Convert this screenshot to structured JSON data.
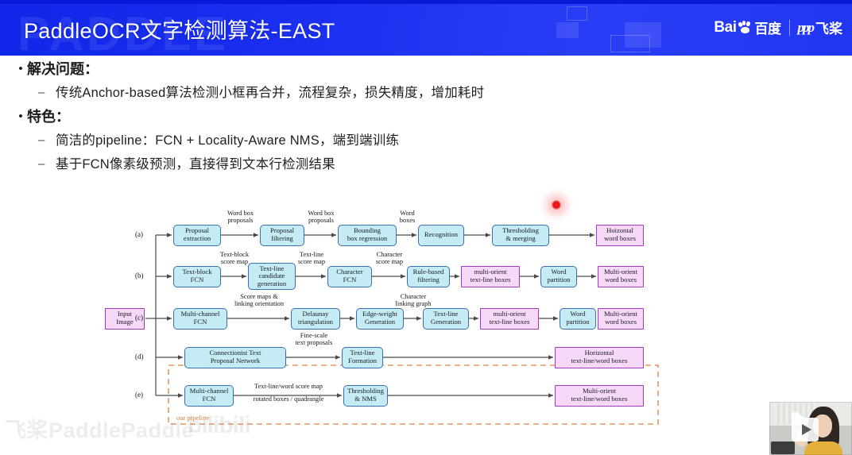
{
  "header": {
    "title": "PaddleOCR文字检测算法-EAST",
    "watermark_text": "PADDLE",
    "logo_baidu_latin": "Bai",
    "logo_baidu_cn": "百度",
    "logo_paddle_mark": "ppp",
    "logo_paddle_cn": "飞桨"
  },
  "content": {
    "bullets": [
      {
        "level": 1,
        "marker": "•",
        "text": "解决问题："
      },
      {
        "level": 2,
        "marker": "–",
        "text": "传统Anchor-based算法检测小框再合并，流程复杂，损失精度，增加耗时"
      },
      {
        "level": 1,
        "marker": "•",
        "text": "特色："
      },
      {
        "level": 2,
        "marker": "–",
        "text": "简洁的pipeline：FCN + Locality-Aware NMS，端到端训练"
      },
      {
        "level": 2,
        "marker": "–",
        "text": "基于FCN像素级预测，直接得到文本行检测结果"
      }
    ]
  },
  "diagram": {
    "input_node": "Input\nImage",
    "input_node_line1": "Input",
    "input_node_line2": "Image",
    "our_pipeline_label": "our pipeline",
    "row_ids": [
      "(a)",
      "(b)",
      "(c)",
      "(d)",
      "(e)"
    ],
    "colors": {
      "process_fill": "#c5ecf5",
      "process_border": "#3a6fae",
      "output_fill": "#f6d9f9",
      "output_border": "#a03ac0",
      "pipeline_box": "#e08040",
      "arrow": "#4a4a4a"
    },
    "rows": [
      {
        "id": "(a)",
        "nodes": [
          {
            "type": "process",
            "line1": "Proposal",
            "line2": "extraction"
          },
          {
            "type": "process",
            "line1": "Proposal",
            "line2": "filtering"
          },
          {
            "type": "process",
            "line1": "Bounding",
            "line2": "box regression"
          },
          {
            "type": "process",
            "line1": "Recognition",
            "line2": ""
          },
          {
            "type": "process",
            "line1": "Thresholding",
            "line2": "& merging"
          },
          {
            "type": "output",
            "line1": "Hoizontal",
            "line2": "word boxes"
          }
        ],
        "edge_labels": [
          {
            "line1": "Word box",
            "line2": "proposals"
          },
          {
            "line1": "Word box",
            "line2": "proposals"
          },
          {
            "line1": "Word",
            "line2": "boxes"
          },
          {
            "line1": "",
            "line2": ""
          },
          {
            "line1": "",
            "line2": ""
          }
        ]
      },
      {
        "id": "(b)",
        "nodes": [
          {
            "type": "process",
            "line1": "Text-block",
            "line2": "FCN"
          },
          {
            "type": "process",
            "line1": "Text-line",
            "line2": "candidate",
            "line3": "generation"
          },
          {
            "type": "process",
            "line1": "Character",
            "line2": "FCN"
          },
          {
            "type": "process",
            "line1": "Rule-based",
            "line2": "filtering"
          },
          {
            "type": "output",
            "line1": "multi-orient",
            "line2": "text-line boxes"
          },
          {
            "type": "process",
            "line1": "Word",
            "line2": "partition"
          },
          {
            "type": "output",
            "line1": "Multi-orient",
            "line2": "word boxes"
          }
        ],
        "edge_labels": [
          {
            "line1": "Text-block",
            "line2": "score map"
          },
          {
            "line1": "Text-line",
            "line2": "score map"
          },
          {
            "line1": "Character",
            "line2": "score map"
          },
          {
            "line1": "",
            "line2": ""
          },
          {
            "line1": "",
            "line2": ""
          },
          {
            "line1": "",
            "line2": ""
          }
        ]
      },
      {
        "id": "(c)",
        "nodes": [
          {
            "type": "process",
            "line1": "Multi-channel",
            "line2": "FCN"
          },
          {
            "type": "process",
            "line1": "Delaunay",
            "line2": "triangulation"
          },
          {
            "type": "process",
            "line1": "Edge-weight",
            "line2": "Generation"
          },
          {
            "type": "process",
            "line1": "Text-line",
            "line2": "Generation"
          },
          {
            "type": "output",
            "line1": "multi-orient",
            "line2": "text-line boxes"
          },
          {
            "type": "process",
            "line1": "Word",
            "line2": "partition"
          },
          {
            "type": "output",
            "line1": "Multi-orient",
            "line2": "word boxes"
          }
        ],
        "edge_labels": [
          {
            "line1": "Score maps &",
            "line2": "linking orientation"
          },
          {
            "line1": "",
            "line2": ""
          },
          {
            "line1": "Character",
            "line2": "linking graph"
          },
          {
            "line1": "",
            "line2": ""
          },
          {
            "line1": "",
            "line2": ""
          },
          {
            "line1": "",
            "line2": ""
          }
        ]
      },
      {
        "id": "(d)",
        "nodes": [
          {
            "type": "process",
            "line1": "Connectionist Text",
            "line2": "Proposal Network"
          },
          {
            "type": "process",
            "line1": "Text-line",
            "line2": "Formation"
          },
          {
            "type": "output",
            "line1": "Horizontal",
            "line2": "text-line/word boxes"
          }
        ],
        "edge_labels": [
          {
            "line1": "Fine-scale",
            "line2": "text proposals"
          },
          {
            "line1": "",
            "line2": ""
          }
        ]
      },
      {
        "id": "(e)",
        "highlighted": true,
        "nodes": [
          {
            "type": "process",
            "line1": "Multi-channel",
            "line2": "FCN"
          },
          {
            "type": "process",
            "line1": "Thresholding",
            "line2": "& NMS"
          },
          {
            "type": "output",
            "line1": "Multi-orient",
            "line2": "text-line/word boxes"
          }
        ],
        "edge_labels": [
          {
            "line1": "Text-line/word score map",
            "line2": "rotated boxes / quadrangle"
          },
          {
            "line1": "",
            "line2": ""
          }
        ]
      }
    ]
  },
  "watermarks": {
    "bottom_left": "飞桨PaddlePaddle",
    "bottom_bilibili": "bilibili"
  },
  "video_overlay": {
    "play_icon": "play-icon"
  }
}
